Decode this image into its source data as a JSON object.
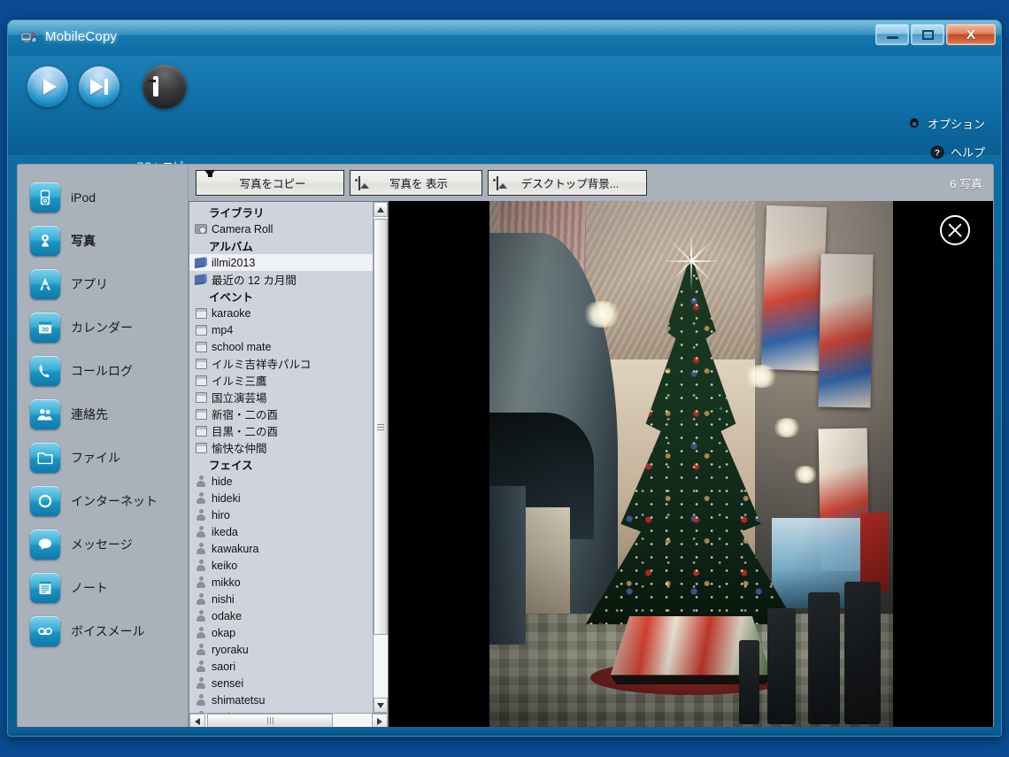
{
  "window": {
    "title": "MobileCopy",
    "app_icon": "app-icon",
    "controls": {
      "minimize": "minimize",
      "maximize": "maximize",
      "close": "X"
    }
  },
  "toolbar": {
    "play_button": "play-icon",
    "next_button": "next-track-icon",
    "copy_to_pc": {
      "icon": "monitor-icon",
      "label": "PCへコピー"
    },
    "links": [
      {
        "icon": "gear-icon",
        "label": "オプション"
      },
      {
        "icon": "help-icon",
        "label": "ヘルプ"
      }
    ]
  },
  "sidebar": {
    "items": [
      {
        "label": "iPod",
        "icon": "ipod-icon",
        "active": false
      },
      {
        "label": "写真",
        "icon": "photo-icon",
        "active": true
      },
      {
        "label": "アプリ",
        "icon": "apps-icon",
        "active": false
      },
      {
        "label": "カレンダー",
        "icon": "calendar-icon",
        "active": false
      },
      {
        "label": "コールログ",
        "icon": "phone-icon",
        "active": false
      },
      {
        "label": "連絡先",
        "icon": "contacts-icon",
        "active": false
      },
      {
        "label": "ファイル",
        "icon": "folder-icon",
        "active": false
      },
      {
        "label": "インターネット",
        "icon": "internet-icon",
        "active": false
      },
      {
        "label": "メッセージ",
        "icon": "message-icon",
        "active": false
      },
      {
        "label": "ノート",
        "icon": "notes-icon",
        "active": false
      },
      {
        "label": "ボイスメール",
        "icon": "voicemail-icon",
        "active": false
      }
    ]
  },
  "main": {
    "buttons": [
      {
        "id": "copy-photos",
        "label": "写真をコピー",
        "icon": "download-arrow-icon"
      },
      {
        "id": "show-photos",
        "label": "写真を 表示",
        "icon": "picture-icon"
      },
      {
        "id": "desktop-bg",
        "label": "デスクトップ背景...",
        "icon": "picture-icon"
      }
    ],
    "photo_count": "6 写真"
  },
  "tree": {
    "groups": [
      {
        "label": "ライブラリ",
        "items": [
          {
            "label": "Camera Roll",
            "icon": "camera-icon",
            "selected": false
          }
        ]
      },
      {
        "label": "アルバム",
        "items": [
          {
            "label": "illmi2013",
            "icon": "album-icon",
            "selected": true
          },
          {
            "label": "最近の 12 カ月間",
            "icon": "album-icon",
            "selected": false
          }
        ]
      },
      {
        "label": "イベント",
        "items": [
          {
            "label": "karaoke",
            "icon": "event-icon",
            "selected": false
          },
          {
            "label": "mp4",
            "icon": "event-icon",
            "selected": false
          },
          {
            "label": "school mate",
            "icon": "event-icon",
            "selected": false
          },
          {
            "label": "イルミ吉祥寺パルコ",
            "icon": "event-icon",
            "selected": false
          },
          {
            "label": "イルミ三鷹",
            "icon": "event-icon",
            "selected": false
          },
          {
            "label": "国立演芸場",
            "icon": "event-icon",
            "selected": false
          },
          {
            "label": "新宿・二の酉",
            "icon": "event-icon",
            "selected": false
          },
          {
            "label": "目黒・二の酉",
            "icon": "event-icon",
            "selected": false
          },
          {
            "label": "愉快な仲間",
            "icon": "event-icon",
            "selected": false
          }
        ]
      },
      {
        "label": "フェイス",
        "items": [
          {
            "label": "hide",
            "icon": "person-icon",
            "selected": false
          },
          {
            "label": "hideki",
            "icon": "person-icon",
            "selected": false
          },
          {
            "label": "hiro",
            "icon": "person-icon",
            "selected": false
          },
          {
            "label": "ikeda",
            "icon": "person-icon",
            "selected": false
          },
          {
            "label": "kawakura",
            "icon": "person-icon",
            "selected": false
          },
          {
            "label": "keiko",
            "icon": "person-icon",
            "selected": false
          },
          {
            "label": "mikko",
            "icon": "person-icon",
            "selected": false
          },
          {
            "label": "nishi",
            "icon": "person-icon",
            "selected": false
          },
          {
            "label": "odake",
            "icon": "person-icon",
            "selected": false
          },
          {
            "label": "okap",
            "icon": "person-icon",
            "selected": false
          },
          {
            "label": "ryoraku",
            "icon": "person-icon",
            "selected": false
          },
          {
            "label": "saori",
            "icon": "person-icon",
            "selected": false
          },
          {
            "label": "sensei",
            "icon": "person-icon",
            "selected": false
          },
          {
            "label": "shimatetsu",
            "icon": "person-icon",
            "selected": false
          },
          {
            "label": "Wakato",
            "icon": "person-icon",
            "selected": false
          }
        ]
      }
    ]
  },
  "viewer": {
    "close_label": "close-icon",
    "photo_description": "夜の商店街アーケードのクリスマスツリー (PARCO)"
  },
  "colors": {
    "window_chrome": "#0f6ca3",
    "content_bg": "#a9b1bb",
    "tree_bg": "#cfd4dc",
    "selection": "#eef1f5",
    "accent_icon": "#1b93c2",
    "close_button": "#c04b21",
    "viewer_bg": "#000000"
  }
}
